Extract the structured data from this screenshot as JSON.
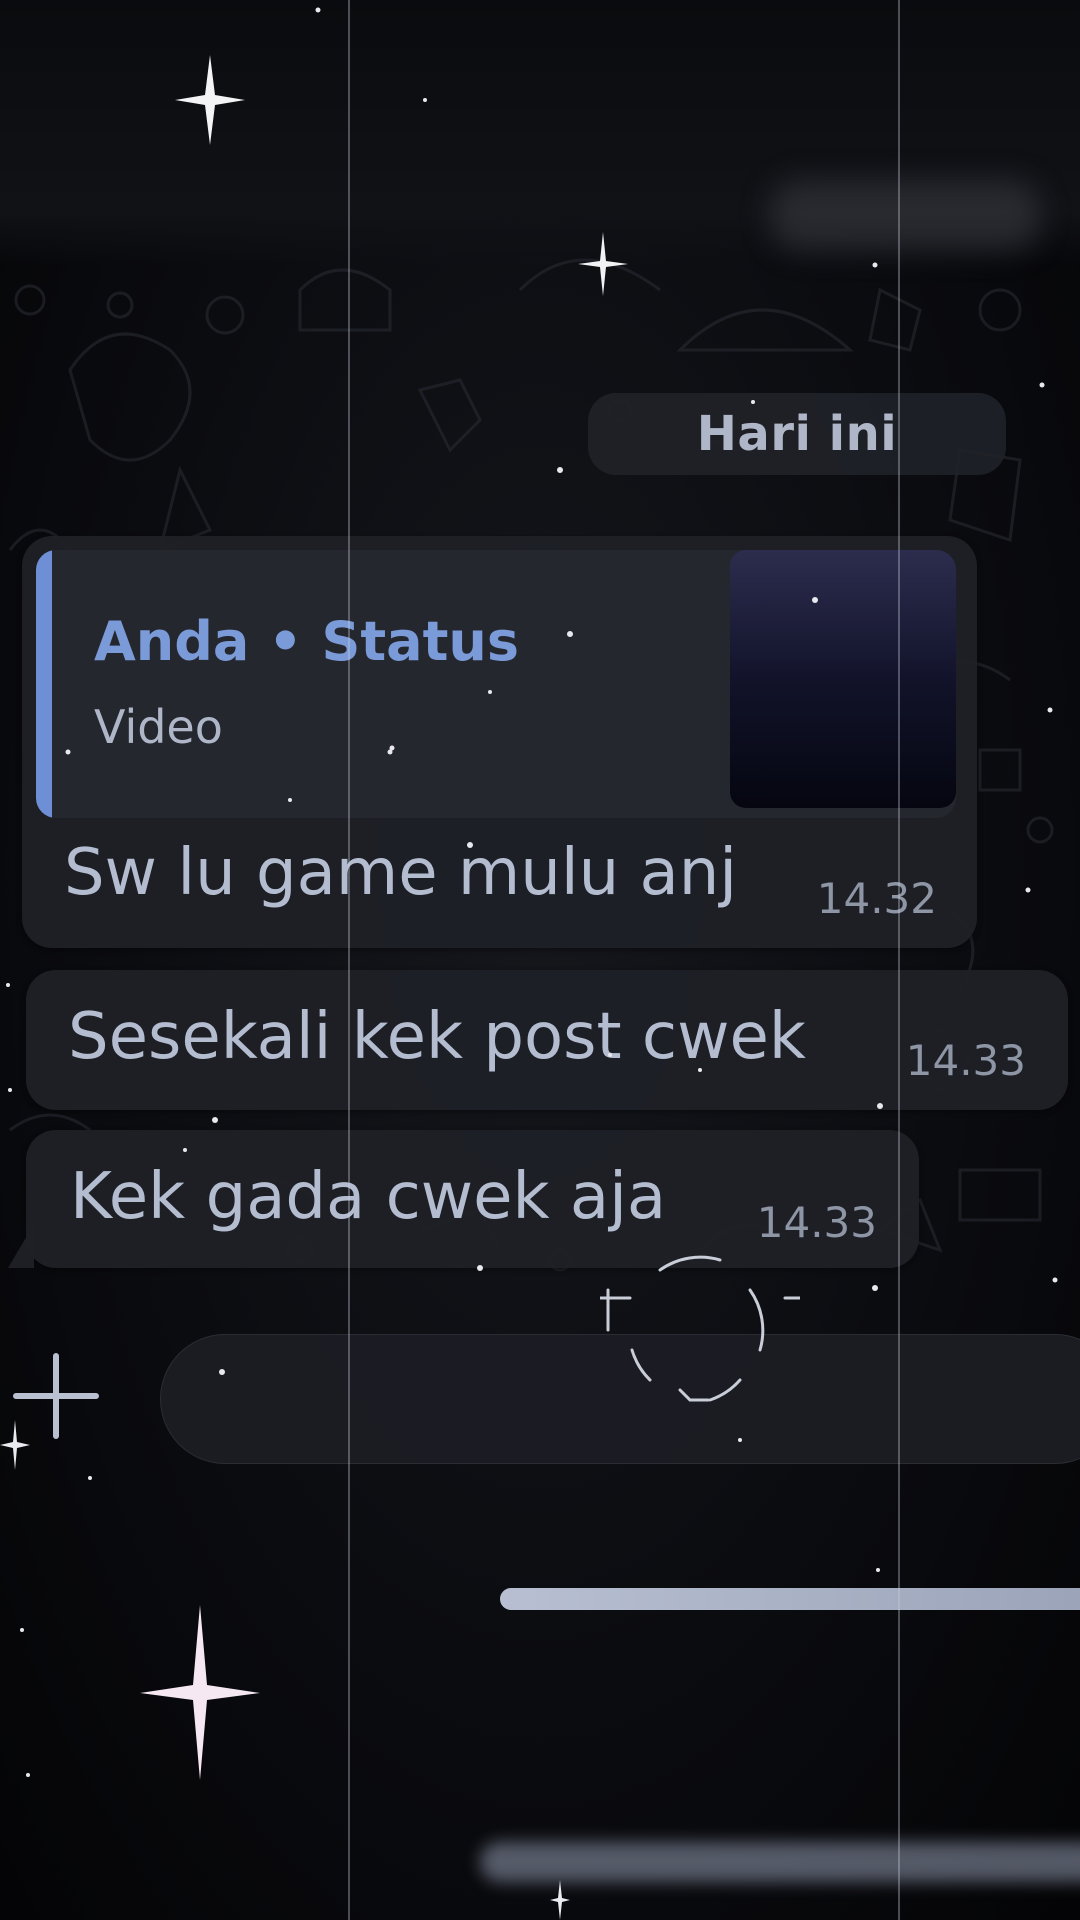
{
  "chat": {
    "date_header": "Hari ini",
    "messages": [
      {
        "quote": {
          "title": "Anda • Status",
          "subtitle": "Video",
          "accent": "#6e8fd6"
        },
        "text": "Sw lu game mulu anj",
        "time": "14.32"
      },
      {
        "text": "Sesekali kek post cwek",
        "time": "14.33"
      },
      {
        "text": "Kek gada cwek aja",
        "time": "14.33"
      }
    ]
  },
  "composer": {
    "attach_icon": "plus-icon",
    "message_value": ""
  },
  "colors": {
    "background": "#06070a",
    "bubble": "#1e2026",
    "quote_accent": "#6e8fd6",
    "text": "#b4bdd0",
    "timestamp": "#8e96a6"
  }
}
